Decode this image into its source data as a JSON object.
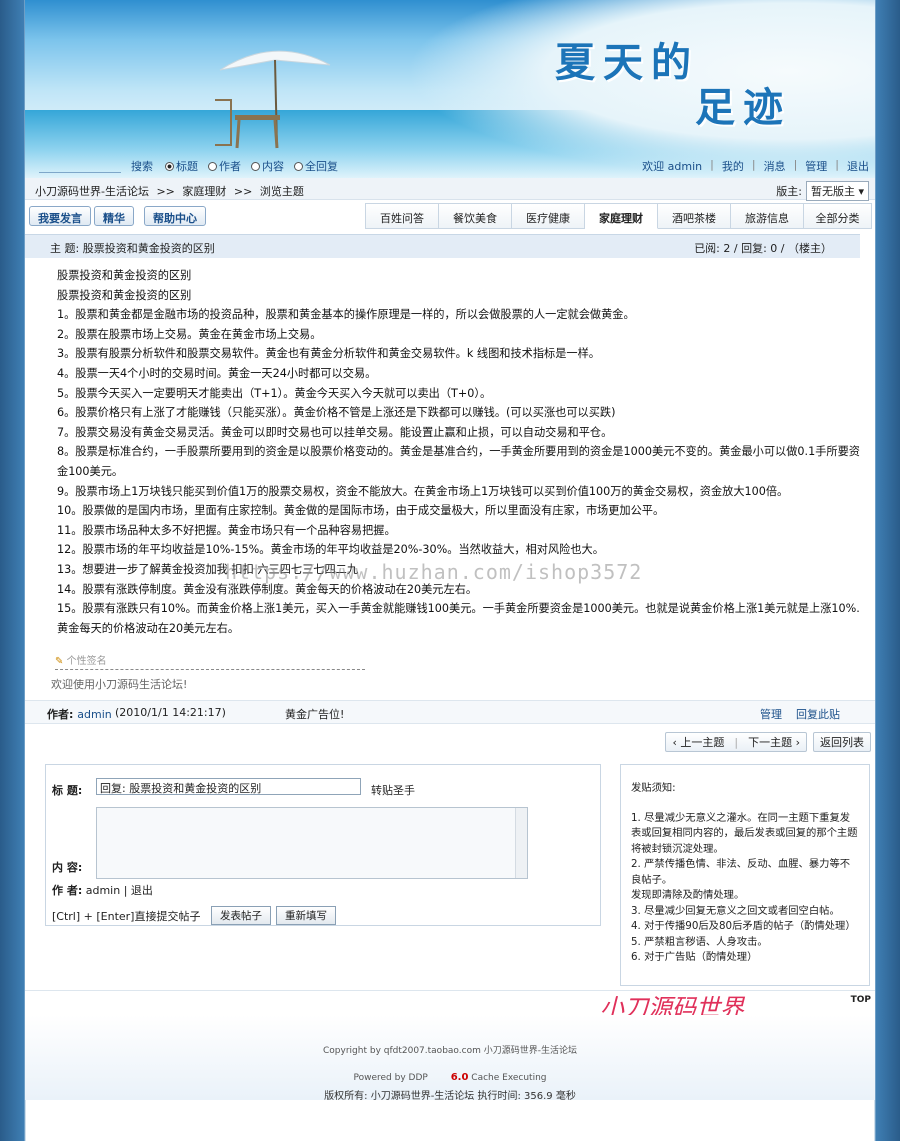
{
  "banner": {
    "title_line1": "夏天的",
    "title_line2": "足迹"
  },
  "search": {
    "button": "搜索",
    "options": [
      {
        "label": "标题",
        "checked": true
      },
      {
        "label": "作者",
        "checked": false
      },
      {
        "label": "内容",
        "checked": false
      },
      {
        "label": "全回复",
        "checked": false
      }
    ]
  },
  "userbar": {
    "welcome": "欢迎",
    "user": "admin",
    "links": [
      "我的",
      "消息",
      "管理",
      "退出"
    ]
  },
  "breadcrumb": {
    "items": [
      "小刀源码世界-生活论坛",
      ">>",
      "家庭理财",
      ">>",
      "浏览主题"
    ],
    "moderator_label": "版主:",
    "moderator_value": "暂无版主"
  },
  "buttons": {
    "post": "我要发言",
    "elite": "精华",
    "help": "帮助中心"
  },
  "categories": [
    "百姓问答",
    "餐饮美食",
    "医疗健康",
    "家庭理财",
    "酒吧茶楼",
    "旅游信息",
    "全部分类"
  ],
  "topic": {
    "subject": "主 题: 股票投资和黄金投资的区别",
    "stats": "已阅: 2 / 回复: 0 / （楼主）"
  },
  "post": {
    "lines": [
      "股票投资和黄金投资的区别",
      "股票投资和黄金投资的区别",
      "1。股票和黄金都是金融市场的投资品种，股票和黄金基本的操作原理是一样的，所以会做股票的人一定就会做黄金。",
      "2。股票在股票市场上交易。黄金在黄金市场上交易。",
      "3。股票有股票分析软件和股票交易软件。黄金也有黄金分析软件和黄金交易软件。k 线图和技术指标是一样。",
      "4。股票一天4个小时的交易时间。黄金一天24小时都可以交易。",
      "5。股票今天买入一定要明天才能卖出（T+1）。黄金今天买入今天就可以卖出（T+0）。",
      "6。股票价格只有上涨了才能赚钱（只能买涨）。黄金价格不管是上涨还是下跌都可以赚钱。(可以买涨也可以买跌)",
      "7。股票交易没有黄金交易灵活。黄金可以即时交易也可以挂单交易。能设置止赢和止损，可以自动交易和平仓。",
      "8。股票是标准合约，一手股票所要用到的资金是以股票价格变动的。黄金是基准合约，一手黄金所要用到的资金是1000美元不变的。黄金最小可以做0.1手所要资金100美元。",
      "9。股票市场上1万块钱只能买到价值1万的股票交易权，资金不能放大。在黄金市场上1万块钱可以买到价值100万的黄金交易权，资金放大100倍。",
      "10。股票做的是国内市场，里面有庄家控制。黄金做的是国际市场，由于成交量极大，所以里面没有庄家，市场更加公平。",
      "11。股票市场品种太多不好把握。黄金市场只有一个品种容易把握。",
      "12。股票市场的年平均收益是10%-15%。黄金市场的年平均收益是20%-30%。当然收益大，相对风险也大。",
      "13。想要进一步了解黄金投资加我    扣扣    六三四七三七四二九",
      "14。股票有涨跌停制度。黄金没有涨跌停制度。黄金每天的价格波动在20美元左右。",
      "15。股票有涨跌只有10%。而黄金价格上涨1美元，买入一手黄金就能赚钱100美元。一手黄金所要资金是1000美元。也就是说黄金价格上涨1美元就是上涨10%.黄金每天的价格波动在20美元左右。"
    ],
    "watermark": "https://www.huzhan.com/ishop3572",
    "signature_label": "个性签名",
    "welcome": "欢迎使用小刀源码生活论坛!"
  },
  "author_bar": {
    "label": "作者:",
    "name": "admin",
    "date": "(2010/1/1 14:21:17)",
    "ad": "黄金广告位!",
    "manage": "管理",
    "reply": "回复此贴"
  },
  "nav": {
    "prev": "上一主题",
    "next": "下一主题",
    "back": "返回列表"
  },
  "reply": {
    "title_label": "标 题:",
    "title_value": "回复: 股票投资和黄金投资的区别",
    "sig_label": "转贴圣手",
    "content_label": "内 容:",
    "author_label": "作 者:",
    "author_value": "admin | 退出",
    "tip": "[Ctrl] + [Enter]直接提交帖子",
    "submit": "发表帖子",
    "reset": "重新填写"
  },
  "rules": {
    "heading": "发贴须知:",
    "items": [
      "1. 尽量减少无意义之灌水。在同一主题下重复发表或回复相同内容的，最后发表或回复的那个主题将被封锁沉淀处理。",
      "2. 严禁传播色情、非法、反动、血腥、暴力等不良帖子。",
      "发现即清除及酌情处理。",
      "3. 尽量减少回复无意义之回文或者回空白帖。",
      "4. 对于传播90后及80后矛盾的帖子（酌情处理）",
      "5. 严禁粗言秽语、人身攻击。",
      "6. 对于广告贴（酌情处理）"
    ]
  },
  "footer": {
    "top": "TOP",
    "brand": "小刀源码世界",
    "copyright": "Copyright by qfdt2007.taobao.com 小刀源码世界-生活论坛",
    "powered_prefix": "Powered by DDP",
    "powered_version": "6.0",
    "powered_suffix": "Cache Executing",
    "rights": "版权所有: 小刀源码世界-生活论坛 执行时间: 356.9 毫秒"
  }
}
